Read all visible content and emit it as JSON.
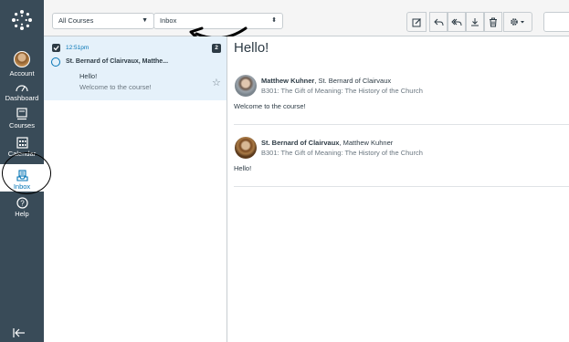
{
  "nav": {
    "items": [
      {
        "name": "account",
        "label": "Account"
      },
      {
        "name": "dashboard",
        "label": "Dashboard"
      },
      {
        "name": "courses",
        "label": "Courses"
      },
      {
        "name": "calendar",
        "label": "Calendar"
      },
      {
        "name": "inbox",
        "label": "Inbox"
      },
      {
        "name": "help",
        "label": "Help"
      }
    ]
  },
  "toolbar": {
    "course_filter": "All Courses",
    "mailbox": "Inbox"
  },
  "conversation": {
    "time": "12:51pm",
    "count": "2",
    "participants": "St. Bernard of Clairvaux, Matthe...",
    "subject": "Hello!",
    "snippet": "Welcome to the course!"
  },
  "view": {
    "title": "Hello!",
    "messages": [
      {
        "author": "Matthew Kuhner",
        "others": ", St. Bernard of Clairvaux",
        "course": "B301: The Gift of Meaning: The History of the Church",
        "body": "Welcome to the course!"
      },
      {
        "author": "St. Bernard of Clairvaux",
        "others": ", Matthew Kuhner",
        "course": "B301: The Gift of Meaning: The History of the Church",
        "body": "Hello!"
      }
    ]
  },
  "colors": {
    "nav_bg": "#394b58",
    "accent": "#0374b5",
    "selected_row": "#e5f1fa"
  }
}
